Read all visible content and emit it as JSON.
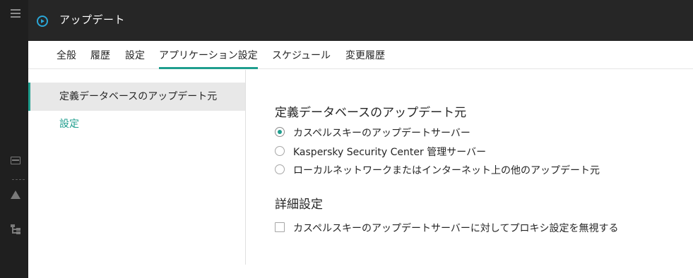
{
  "header": {
    "title": "アップデート"
  },
  "tabs": [
    {
      "label": "全般"
    },
    {
      "label": "履歴"
    },
    {
      "label": "設定"
    },
    {
      "label": "アプリケーション設定",
      "active": true
    },
    {
      "label": "スケジュール"
    },
    {
      "label": "変更履歴"
    }
  ],
  "sidebar": {
    "items": [
      {
        "label": "定義データベースのアップデート元",
        "selected": true
      },
      {
        "label": "設定"
      }
    ]
  },
  "main": {
    "section_title": "定義データベースのアップデート元",
    "sources": [
      {
        "label": "カスペルスキーのアップデートサーバー",
        "checked": true
      },
      {
        "label": "Kaspersky Security Center 管理サーバー",
        "checked": false
      },
      {
        "label": "ローカルネットワークまたはインターネット上の他のアップデート元",
        "checked": false
      }
    ],
    "advanced_title": "詳細設定",
    "proxy_checkbox": {
      "label": "カスペルスキーのアップデートサーバーに対してプロキシ設定を無視する",
      "checked": false
    }
  },
  "colors": {
    "accent": "#1f9e8e",
    "header_bg": "#262626",
    "rail_bg": "#1f1f1f",
    "back_icon": "#2aa6d6"
  },
  "icons": [
    "menu-icon",
    "list-icon",
    "warning-icon",
    "tree-icon",
    "back-icon"
  ]
}
